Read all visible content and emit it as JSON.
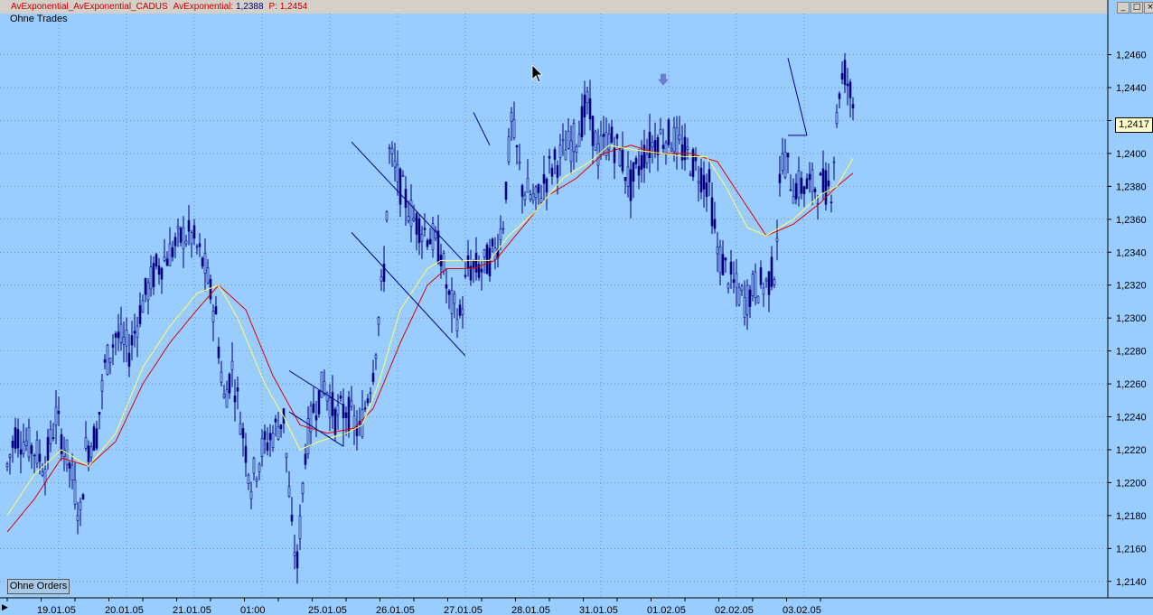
{
  "window": {
    "title_name": "AvExponential_AvExponential_CADUS",
    "title_indicator": "AvExponential:",
    "title_value": "1,2388",
    "title_p_label": "P:",
    "title_p_value": "1,2454",
    "subtitle": "Ohne Trades",
    "orders_button": "Ohne Orders",
    "current_price_tag": "1,2417",
    "buttons": [
      "minimize",
      "maximize",
      "close"
    ]
  },
  "colors": {
    "background": "#99ccff",
    "grid": "#5a6e8a",
    "candles": "#000080",
    "ema_fast": "#ffff66",
    "ema_slow": "#e00000",
    "trendlines": "#00008b",
    "marker": "#6a7fd0"
  },
  "chart_data": {
    "type": "candlestick",
    "grid": true,
    "ylim": [
      1.213,
      1.2485
    ],
    "yticks": [
      "1,2460",
      "1,2440",
      "1,2420",
      "1,2400",
      "1,2380",
      "1,2360",
      "1,2340",
      "1,2320",
      "1,2300",
      "1,2280",
      "1,2260",
      "1,2240",
      "1,2220",
      "1,2200",
      "1,2180",
      "1,2160",
      "1,2140"
    ],
    "ytick_values": [
      1.246,
      1.244,
      1.242,
      1.24,
      1.238,
      1.236,
      1.234,
      1.232,
      1.23,
      1.228,
      1.226,
      1.224,
      1.222,
      1.22,
      1.218,
      1.216,
      1.214
    ],
    "xticks": [
      "19.01.05",
      "20.01.05",
      "21.01.05",
      "01:00",
      "25.01.05",
      "26.01.05",
      "27.01.05",
      "28.01.05",
      "31.01.05",
      "01.02.05",
      "02.02.05",
      "03.02.05"
    ],
    "xtick_index": [
      19,
      44,
      69,
      94,
      119,
      144,
      169,
      194,
      219,
      244,
      269,
      294
    ],
    "x_count": 310,
    "current_price": 1.2417,
    "close_keypoints": [
      [
        0,
        1.221
      ],
      [
        3,
        1.223
      ],
      [
        10,
        1.222
      ],
      [
        14,
        1.221
      ],
      [
        18,
        1.224
      ],
      [
        23,
        1.221
      ],
      [
        27,
        1.218
      ],
      [
        29,
        1.222
      ],
      [
        33,
        1.223
      ],
      [
        36,
        1.227
      ],
      [
        40,
        1.229
      ],
      [
        45,
        1.228
      ],
      [
        50,
        1.231
      ],
      [
        55,
        1.233
      ],
      [
        60,
        1.234
      ],
      [
        65,
        1.235
      ],
      [
        68,
        1.235
      ],
      [
        73,
        1.233
      ],
      [
        77,
        1.23
      ],
      [
        80,
        1.225
      ],
      [
        83,
        1.227
      ],
      [
        87,
        1.223
      ],
      [
        90,
        1.22
      ],
      [
        94,
        1.222
      ],
      [
        98,
        1.223
      ],
      [
        102,
        1.224
      ],
      [
        105,
        1.217
      ],
      [
        107,
        1.215
      ],
      [
        110,
        1.222
      ],
      [
        113,
        1.2245
      ],
      [
        117,
        1.226
      ],
      [
        121,
        1.224
      ],
      [
        125,
        1.2245
      ],
      [
        130,
        1.223
      ],
      [
        135,
        1.227
      ],
      [
        139,
        1.233
      ],
      [
        141,
        1.24
      ],
      [
        145,
        1.238
      ],
      [
        150,
        1.236
      ],
      [
        156,
        1.235
      ],
      [
        160,
        1.234
      ],
      [
        163,
        1.231
      ],
      [
        167,
        1.23
      ],
      [
        170,
        1.233
      ],
      [
        175,
        1.233
      ],
      [
        180,
        1.234
      ],
      [
        183,
        1.236
      ],
      [
        186,
        1.242
      ],
      [
        190,
        1.238
      ],
      [
        195,
        1.237
      ],
      [
        200,
        1.239
      ],
      [
        205,
        1.24
      ],
      [
        210,
        1.241
      ],
      [
        214,
        1.243
      ],
      [
        218,
        1.24
      ],
      [
        222,
        1.241
      ],
      [
        226,
        1.24
      ],
      [
        230,
        1.238
      ],
      [
        235,
        1.24
      ],
      [
        240,
        1.241
      ],
      [
        245,
        1.241
      ],
      [
        250,
        1.24
      ],
      [
        255,
        1.239
      ],
      [
        259,
        1.238
      ],
      [
        262,
        1.234
      ],
      [
        265,
        1.233
      ],
      [
        268,
        1.232
      ],
      [
        272,
        1.231
      ],
      [
        276,
        1.232
      ],
      [
        280,
        1.232
      ],
      [
        283,
        1.233
      ],
      [
        286,
        1.24
      ],
      [
        290,
        1.238
      ],
      [
        295,
        1.238
      ],
      [
        300,
        1.238
      ],
      [
        304,
        1.238
      ],
      [
        307,
        1.244
      ],
      [
        309,
        1.245
      ],
      [
        312,
        1.243
      ]
    ],
    "ema_fast_keypoints": [
      [
        0,
        1.218
      ],
      [
        10,
        1.2205
      ],
      [
        20,
        1.222
      ],
      [
        30,
        1.221
      ],
      [
        40,
        1.223
      ],
      [
        50,
        1.227
      ],
      [
        60,
        1.2295
      ],
      [
        70,
        1.2315
      ],
      [
        78,
        1.232
      ],
      [
        85,
        1.23
      ],
      [
        95,
        1.226
      ],
      [
        102,
        1.224
      ],
      [
        108,
        1.222
      ],
      [
        115,
        1.2225
      ],
      [
        125,
        1.223
      ],
      [
        131,
        1.2235
      ],
      [
        137,
        1.226
      ],
      [
        145,
        1.2305
      ],
      [
        155,
        1.233
      ],
      [
        160,
        1.2335
      ],
      [
        170,
        1.2335
      ],
      [
        178,
        1.2335
      ],
      [
        185,
        1.235
      ],
      [
        195,
        1.2365
      ],
      [
        205,
        1.2385
      ],
      [
        215,
        1.2395
      ],
      [
        222,
        1.2405
      ],
      [
        232,
        1.2402
      ],
      [
        242,
        1.24
      ],
      [
        250,
        1.2398
      ],
      [
        258,
        1.2398
      ],
      [
        265,
        1.238
      ],
      [
        273,
        1.2355
      ],
      [
        280,
        1.235
      ],
      [
        290,
        1.236
      ],
      [
        300,
        1.2375
      ],
      [
        306,
        1.238
      ],
      [
        312,
        1.2397
      ]
    ],
    "ema_slow_keypoints": [
      [
        0,
        1.217
      ],
      [
        10,
        1.219
      ],
      [
        20,
        1.2215
      ],
      [
        30,
        1.221
      ],
      [
        40,
        1.2225
      ],
      [
        50,
        1.226
      ],
      [
        60,
        1.2285
      ],
      [
        70,
        1.2305
      ],
      [
        78,
        1.232
      ],
      [
        88,
        1.2305
      ],
      [
        98,
        1.2265
      ],
      [
        108,
        1.2235
      ],
      [
        118,
        1.223
      ],
      [
        128,
        1.2233
      ],
      [
        135,
        1.2245
      ],
      [
        145,
        1.2285
      ],
      [
        155,
        1.232
      ],
      [
        162,
        1.233
      ],
      [
        172,
        1.233
      ],
      [
        180,
        1.2335
      ],
      [
        190,
        1.2355
      ],
      [
        200,
        1.2375
      ],
      [
        210,
        1.2385
      ],
      [
        220,
        1.24
      ],
      [
        230,
        1.2405
      ],
      [
        240,
        1.24
      ],
      [
        252,
        1.24
      ],
      [
        262,
        1.2395
      ],
      [
        272,
        1.237
      ],
      [
        280,
        1.235
      ],
      [
        290,
        1.2357
      ],
      [
        300,
        1.237
      ],
      [
        306,
        1.238
      ],
      [
        312,
        1.2388
      ]
    ],
    "trendline_segments": [
      [
        [
          104,
          1.2268
        ],
        [
          124,
          1.2247
        ]
      ],
      [
        [
          104,
          1.2243
        ],
        [
          124,
          1.2222
        ]
      ],
      [
        [
          124,
          1.2247
        ],
        [
          124,
          1.2222
        ]
      ],
      [
        [
          127,
          1.2407
        ],
        [
          168,
          1.2335
        ]
      ],
      [
        [
          127,
          1.2352
        ],
        [
          169,
          1.2277
        ]
      ],
      [
        [
          172,
          1.2425
        ],
        [
          178,
          1.2405
        ]
      ],
      [
        [
          288,
          1.2458
        ],
        [
          295,
          1.2411
        ]
      ],
      [
        [
          288,
          1.2411
        ],
        [
          295,
          1.2411
        ]
      ]
    ],
    "marker_arrow_index": 242,
    "marker_arrow_value": 1.2444
  }
}
